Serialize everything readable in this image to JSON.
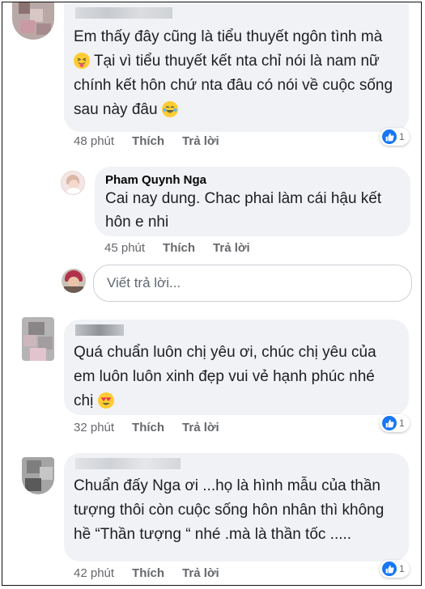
{
  "comments": [
    {
      "text": "Em thấy đây cũng là tiểu thuyết ngôn tình mà",
      "text2": "Tại vì tiểu thuyết kết nta chỉ nói là nam nữ chính kết hôn chứ nta đâu có nói về cuộc sống sau này đâu",
      "time": "48 phút",
      "like": "Thích",
      "reply": "Trả lời",
      "like_count": "1"
    },
    {
      "author": "Pham Quynh Nga",
      "text": "Cai nay dung. Chac phai làm cái hậu kết hôn e nhi",
      "time": "45 phút",
      "like": "Thích",
      "reply": "Trả lời"
    },
    {
      "text": "Quá chuẩn luôn chị yêu ơi, chúc chị yêu của em luôn luôn xinh đẹp vui vẻ hạnh phúc nhé chị",
      "time": "32 phút",
      "like": "Thích",
      "reply": "Trả lời",
      "like_count": "1"
    },
    {
      "text": "Chuẩn đấy Nga ơi ...họ là hình mẫu của thần tượng thôi còn cuộc sống hôn nhân thì không hề “Thần tượng “ nhé .mà là thần tốc .....",
      "time": "42 phút",
      "like": "Thích",
      "reply": "Trả lời",
      "like_count": "1"
    }
  ],
  "reply_box": {
    "placeholder": "Viết trả lời..."
  },
  "colors": {
    "bubble": "#f0f2f5",
    "meta": "#65676b",
    "like_blue": "#1877f2"
  }
}
